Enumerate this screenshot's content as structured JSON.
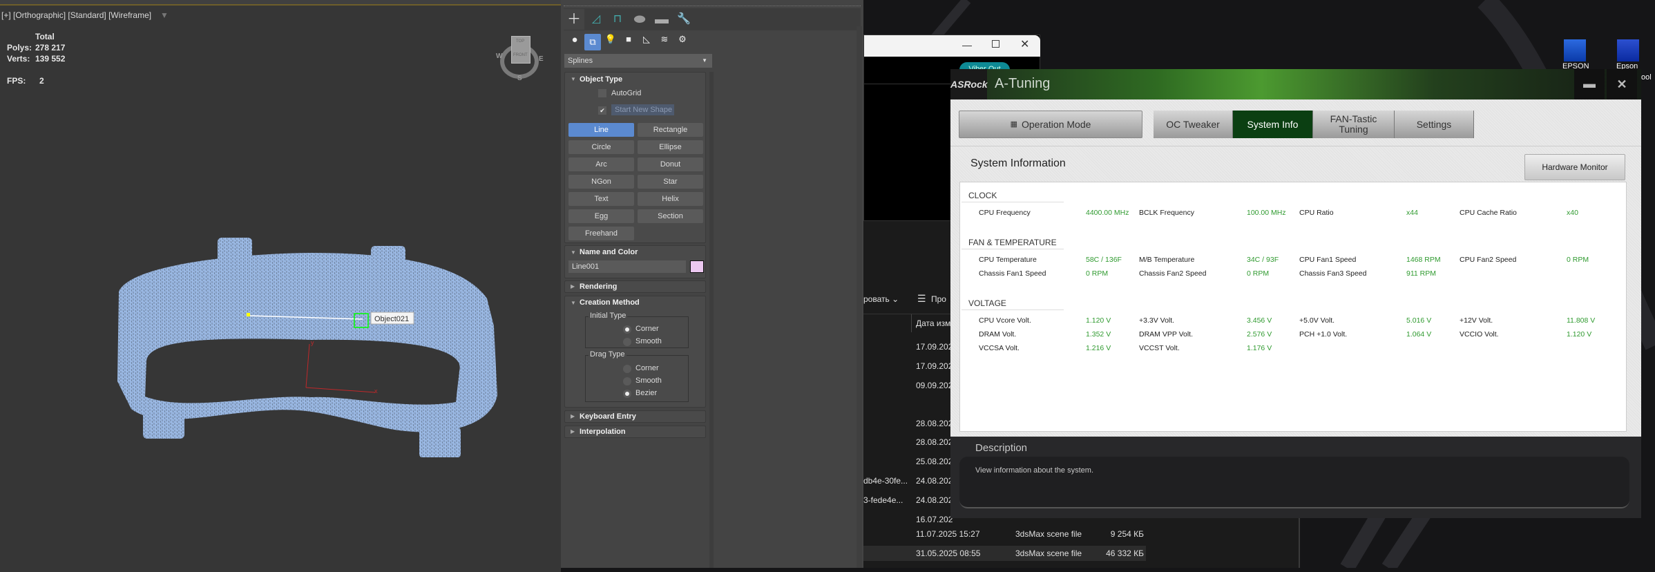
{
  "viewport": {
    "label": "[+] [Orthographic] [Standard] [Wireframe]",
    "stats": {
      "total_label": "Total",
      "polys_label": "Polys:",
      "polys": "278 217",
      "verts_label": "Verts:",
      "verts": "139 552",
      "fps_label": "FPS:",
      "fps": "2"
    },
    "viewcube": {
      "top": "TOP",
      "front": "FRONT",
      "w": "W",
      "e": "E",
      "s": "S"
    },
    "object_label": "Object021",
    "axis_x": "x",
    "axis_y": "y",
    "wire_color": "#9ab8e3"
  },
  "command_panel": {
    "category": "Splines",
    "object_type": {
      "title": "Object Type",
      "autogrid": "AutoGrid",
      "start_new_shape": "Start New Shape",
      "buttons": [
        "Line",
        "Rectangle",
        "Circle",
        "Ellipse",
        "Arc",
        "Donut",
        "NGon",
        "Star",
        "Text",
        "Helix",
        "Egg",
        "Section",
        "Freehand"
      ],
      "active": "Line"
    },
    "name_color": {
      "title": "Name and Color",
      "name": "Line001",
      "color": "#ecc8f0"
    },
    "rendering": "Rendering",
    "creation_method": {
      "title": "Creation Method",
      "initial_type": {
        "label": "Initial Type",
        "options": [
          "Corner",
          "Smooth"
        ],
        "selected": "Corner"
      },
      "drag_type": {
        "label": "Drag Type",
        "options": [
          "Corner",
          "Smooth",
          "Bezier"
        ],
        "selected": "Bezier"
      }
    },
    "keyboard_entry": "Keyboard Entry",
    "interpolation": "Interpolation"
  },
  "background_window": {
    "button": "Viber Out"
  },
  "explorer": {
    "toolbar": {
      "sort": "ровать",
      "view": "Про"
    },
    "column_date": "Дата изм",
    "names": [
      "db4e-30fe...",
      "3-fede4e..."
    ],
    "dates": [
      "17.09.202",
      "17.09.202",
      "09.09.202",
      "28.08.202",
      "28.08.202",
      "25.08.202",
      "24.08.202",
      "24.08.202",
      "16.07.202"
    ],
    "files": [
      {
        "date": "11.07.2025 15:27",
        "type": "3dsMax scene file",
        "size": "9 254 КБ"
      },
      {
        "date": "31.05.2025 08:55",
        "type": "3dsMax scene file",
        "size": "46 332 КБ"
      }
    ]
  },
  "desktop": {
    "icons": [
      "EPSON",
      "Epson"
    ],
    "partial": "ool"
  },
  "atuning": {
    "brand": "ASRock",
    "title": "A-Tuning",
    "operation_mode": "Operation Mode",
    "tabs": [
      "OC Tweaker",
      "System Info",
      "FAN-Tastic Tuning",
      "Settings"
    ],
    "active_tab": "System Info",
    "heading": "System Information",
    "hardware_monitor": "Hardware Monitor",
    "sections": [
      {
        "title": "CLOCK",
        "rows": [
          [
            [
              "CPU Frequency",
              "4400.00 MHz"
            ],
            [
              "BCLK Frequency",
              "100.00 MHz"
            ],
            [
              "CPU Ratio",
              "x44"
            ],
            [
              "CPU Cache Ratio",
              "x40"
            ]
          ]
        ]
      },
      {
        "title": "FAN & TEMPERATURE",
        "rows": [
          [
            [
              "CPU Temperature",
              "58C / 136F"
            ],
            [
              "M/B Temperature",
              "34C / 93F"
            ],
            [
              "CPU Fan1 Speed",
              "1468 RPM"
            ],
            [
              "CPU Fan2 Speed",
              "0 RPM"
            ]
          ],
          [
            [
              "Chassis Fan1 Speed",
              "0 RPM"
            ],
            [
              "Chassis Fan2 Speed",
              "0 RPM"
            ],
            [
              "Chassis Fan3 Speed",
              "911 RPM"
            ]
          ]
        ]
      },
      {
        "title": "VOLTAGE",
        "rows": [
          [
            [
              "CPU Vcore Volt.",
              "1.120 V"
            ],
            [
              "+3.3V Volt.",
              "3.456 V"
            ],
            [
              "+5.0V Volt.",
              "5.016 V"
            ],
            [
              "+12V Volt.",
              "11.808 V"
            ]
          ],
          [
            [
              "DRAM Volt.",
              "1.352 V"
            ],
            [
              "DRAM VPP Volt.",
              "2.576 V"
            ],
            [
              "PCH +1.0 Volt.",
              "1.064 V"
            ],
            [
              "VCCIO Volt.",
              "1.120 V"
            ]
          ],
          [
            [
              "VCCSA Volt.",
              "1.216 V"
            ],
            [
              "VCCST Volt.",
              "1.176 V"
            ]
          ]
        ]
      }
    ],
    "description": {
      "title": "Description",
      "text": "View information about the system."
    }
  }
}
